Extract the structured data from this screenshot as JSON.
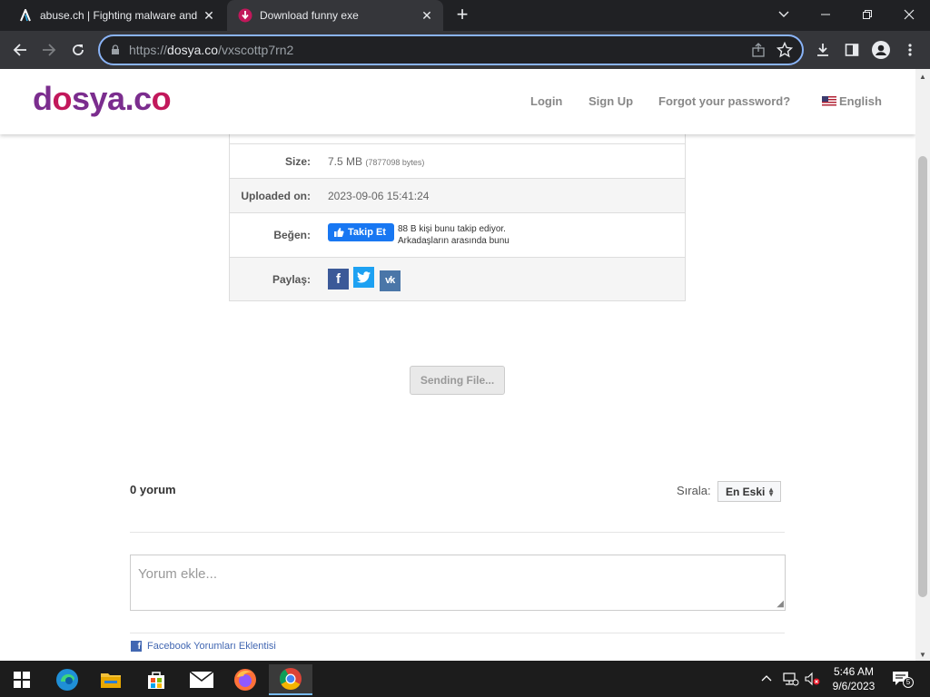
{
  "browser": {
    "tabs": [
      {
        "title": "abuse.ch | Fighting malware and",
        "favicon": "abuse-ch-logo",
        "active": false
      },
      {
        "title": "Download funny exe",
        "favicon": "dosya-logo",
        "active": true
      }
    ],
    "url": {
      "scheme": "https://",
      "host": "dosya.co",
      "path": "/vxscottp7rn2"
    },
    "window_controls": [
      "minimize-icon",
      "restore-icon",
      "close-icon"
    ]
  },
  "site": {
    "logo": {
      "part1": "d",
      "o1": "o",
      "part2": "sya.c",
      "o2": "o"
    },
    "nav": {
      "login": "Login",
      "signup": "Sign Up",
      "forgot": "Forgot your password?",
      "language": "English"
    }
  },
  "file_info": {
    "size_label": "Size:",
    "size_value": "7.5 MB",
    "size_bytes": "(7877098 bytes)",
    "uploaded_label": "Uploaded on:",
    "uploaded_value": "2023-09-06 15:41:24",
    "like_label": "Beğen:",
    "follow_button": "Takip Et",
    "follow_text_line1": "88 B kişi bunu takip ediyor.",
    "follow_text_line2": "Arkadaşların arasında bunu",
    "share_label": "Paylaş:",
    "share_icons": [
      "facebook-icon",
      "twitter-icon",
      "vk-icon"
    ]
  },
  "download": {
    "button_label": "Sending File..."
  },
  "comments": {
    "count_label": "0 yorum",
    "sort_label": "Sırala:",
    "sort_value": "En Eski",
    "placeholder": "Yorum ekle...",
    "plugin_label": "Facebook Yorumları Eklentisi"
  },
  "taskbar": {
    "apps": [
      "windows-start-icon",
      "edge-icon",
      "file-explorer-icon",
      "store-icon",
      "mail-icon",
      "firefox-icon",
      "chrome-icon"
    ],
    "time": "5:46 AM",
    "date": "9/6/2023",
    "notifications": "5"
  },
  "colors": {
    "logo_purple": "#7b2d8e",
    "logo_pink": "#c2185b",
    "facebook": "#3b5998",
    "twitter": "#1da1f2",
    "vk": "#4a76a8",
    "omnibox_focus": "#8ab4f8"
  }
}
